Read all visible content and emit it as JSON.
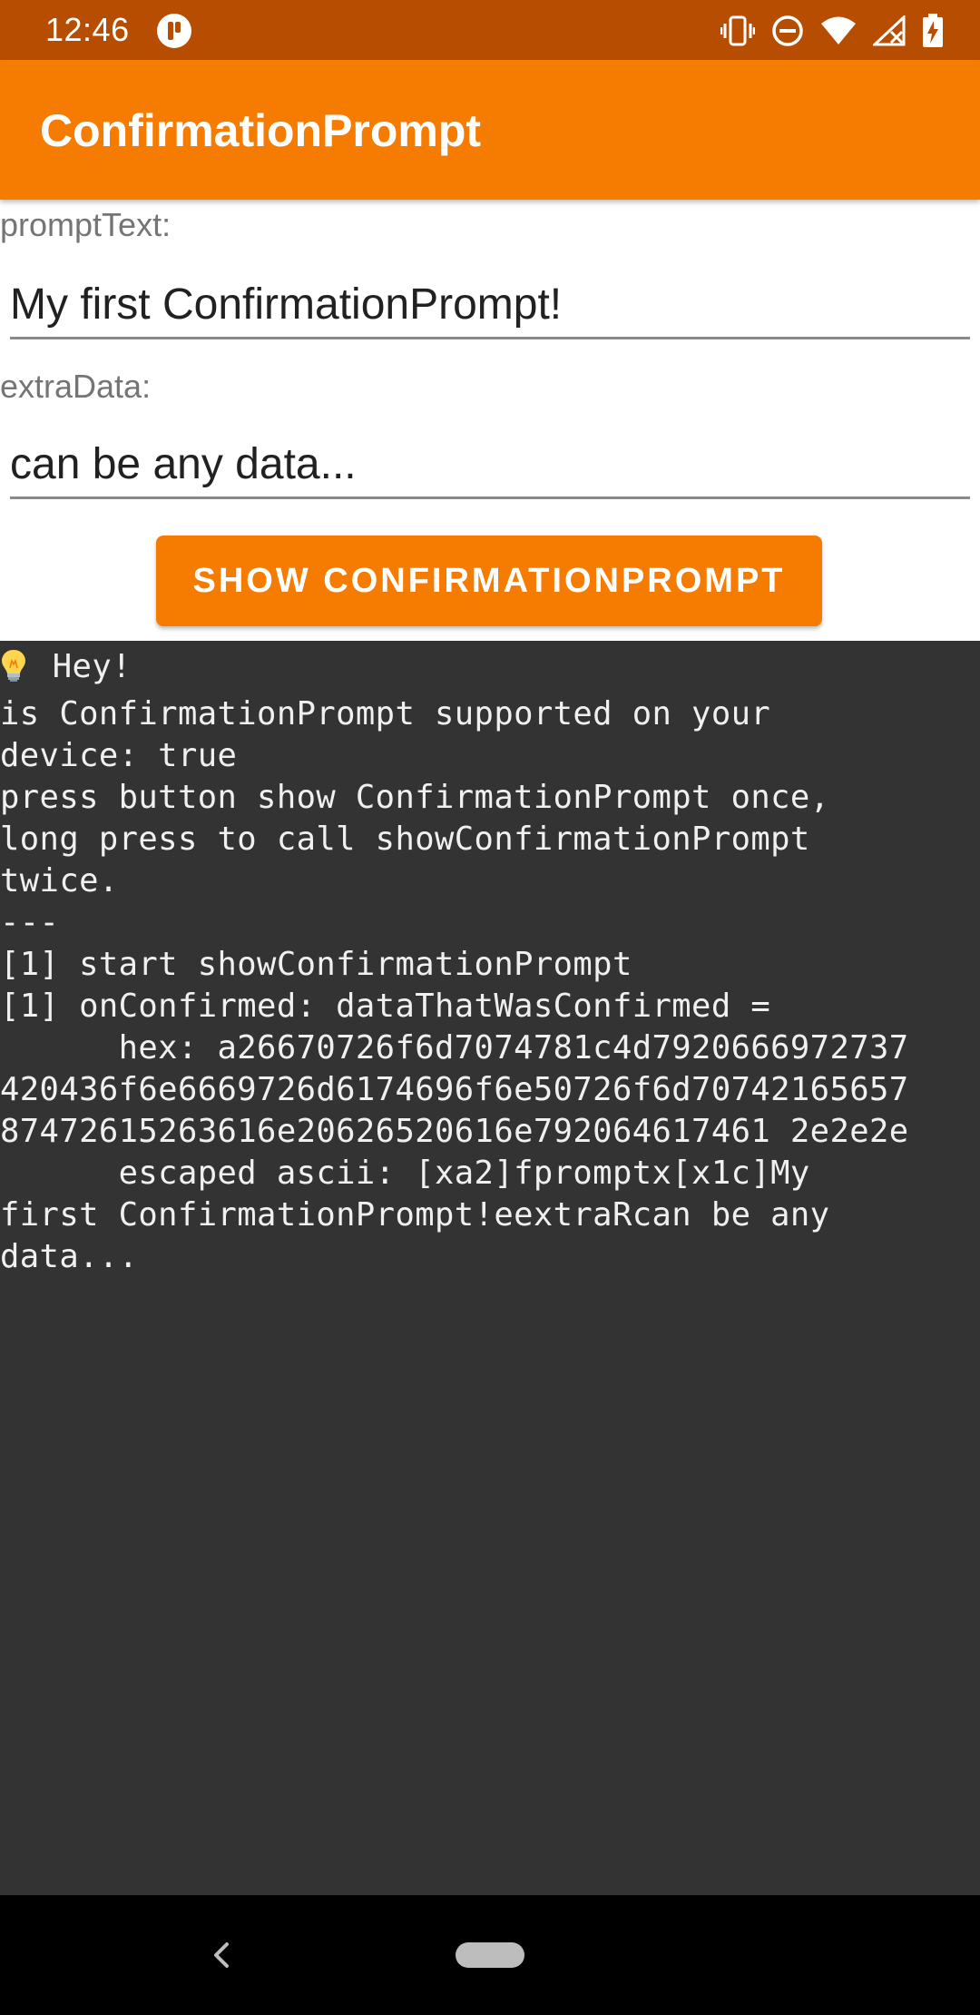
{
  "status_bar": {
    "time": "12:46",
    "icons": [
      "app-notification-icon",
      "vibrate-icon",
      "do-not-disturb-icon",
      "wifi-icon",
      "cellular-no-signal-icon",
      "battery-charging-icon"
    ]
  },
  "app_bar": {
    "title": "ConfirmationPrompt"
  },
  "form": {
    "prompt_text_label": "promptText:",
    "prompt_text_value": "My first ConfirmationPrompt!",
    "extra_data_label": "extraData:",
    "extra_data_value": "can be any data...",
    "button_label": "SHOW CONFIRMATIONPROMPT"
  },
  "log": {
    "first_line_text": " Hey!",
    "lines": [
      "is ConfirmationPrompt supported on your",
      "device: true",
      "press button show ConfirmationPrompt once,",
      "long press to call showConfirmationPrompt",
      "twice.",
      "---",
      "[1] start showConfirmationPrompt",
      "[1] onConfirmed: dataThatWasConfirmed =",
      "      hex: a26670726f6d7074781c4d7920666972737",
      "420436f6e6669726d6174696f6e50726f6d70742165657",
      "87472615263616e20626520616e792064617461 2e2e2e",
      "      escaped ascii: [xa2]fpromptx[x1c]My",
      "first ConfirmationPrompt!eextraRcan be any",
      "data..."
    ]
  },
  "colors": {
    "status_bar": "#b74d00",
    "accent": "#f57c00",
    "console_bg": "#333333",
    "console_text": "#f0f0f0"
  }
}
